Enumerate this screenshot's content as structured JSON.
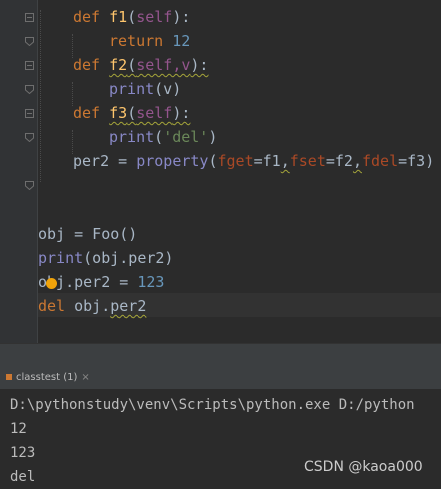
{
  "editor": {
    "code": {
      "l1": {
        "kw": "def",
        "fn": "f1",
        "open": "(",
        "self": "self",
        "close": "):"
      },
      "l2": {
        "kw": "return",
        "num": "12"
      },
      "l3": {
        "kw": "def",
        "fn": "f2",
        "open": "(",
        "params": "self,v",
        "close": "):"
      },
      "l4": {
        "builtin": "print",
        "args": "(v)"
      },
      "l5": {
        "kw": "def",
        "fn": "f3",
        "open": "(",
        "self": "self",
        "close": "):"
      },
      "l6": {
        "builtin": "print",
        "open": "(",
        "str": "'del'",
        "close": ")"
      },
      "l7": {
        "lhs": "per2 = ",
        "builtin": "property",
        "open": "(",
        "fget": "fget",
        "eq1": "=f1",
        "c1": ",",
        "fset": "fset",
        "eq2": "=f2",
        "c2": ",",
        "fdel": "fdel",
        "eq3": "=f3",
        "close": ")"
      },
      "l8": {
        "text": "obj = Foo()"
      },
      "l9": {
        "builtin": "print",
        "args": "(obj.per2)"
      },
      "l10": {
        "o": "o",
        "rest": "bj.per2 = ",
        "num": "123"
      },
      "l11": {
        "kw": "del",
        "space": " obj.",
        "attr": "per2"
      }
    }
  },
  "run_panel": {
    "tab_label": "classtest",
    "tab_count": "(1)",
    "close_glyph": "×"
  },
  "console": {
    "lines": [
      "D:\\pythonstudy\\venv\\Scripts\\python.exe D:/python",
      "12",
      "123",
      "del"
    ]
  },
  "watermark": "CSDN @kaoa000"
}
